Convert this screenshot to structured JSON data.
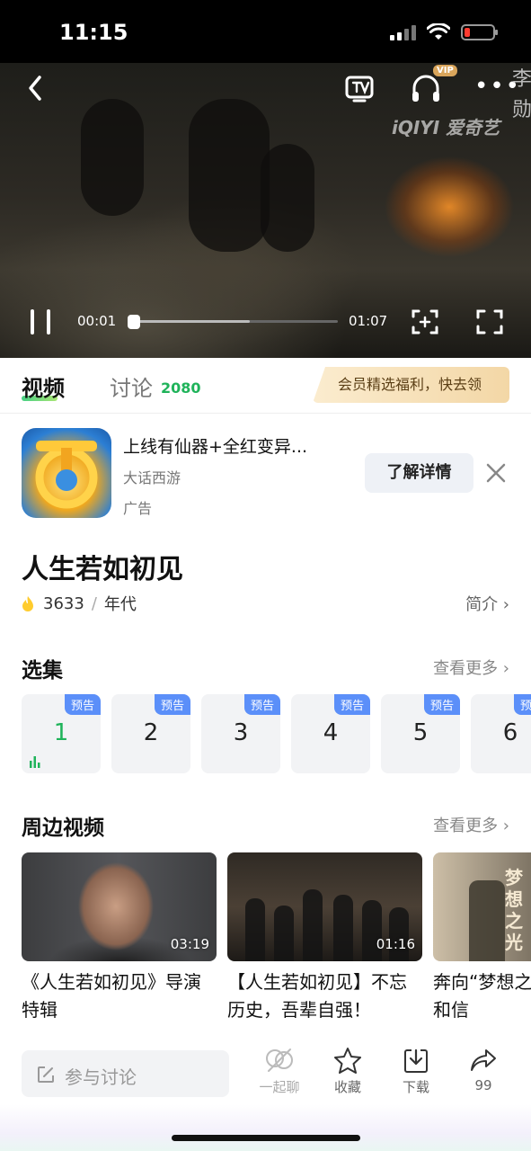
{
  "status_bar": {
    "time": "11:15"
  },
  "player": {
    "watermark": "iQIYI 爱奇艺",
    "vip_badge": "VIP",
    "cut_text": "李勋",
    "current_time": "00:01",
    "total_time": "01:07",
    "progress_fraction": 0.01,
    "buffered_fraction": 0.58
  },
  "tabs": {
    "video": "视频",
    "discuss": "讨论",
    "discuss_count": "2080",
    "promo": "会员精选福利，快去领"
  },
  "ad": {
    "title": "上线有仙器+全红变异...",
    "brand": "大话西游",
    "label": "广告",
    "cta": "了解详情"
  },
  "show": {
    "title": "人生若如初见",
    "heat": "3633",
    "separator": "/",
    "category": "年代",
    "intro": "简介 ›"
  },
  "episodes_section": {
    "title": "选集",
    "more": "查看更多 ›",
    "items": [
      {
        "num": "1",
        "badge": "预告",
        "active": true
      },
      {
        "num": "2",
        "badge": "预告"
      },
      {
        "num": "3",
        "badge": "预告"
      },
      {
        "num": "4",
        "badge": "预告"
      },
      {
        "num": "5",
        "badge": "预告"
      },
      {
        "num": "6",
        "badge": "预告"
      }
    ]
  },
  "related_section": {
    "title": "周边视频",
    "more": "查看更多 ›",
    "items": [
      {
        "title": "《人生若如初见》导演特辑",
        "duration": "03:19"
      },
      {
        "title": "【人生若如初见】不忘历史，吾辈自强！",
        "duration": "01:16"
      },
      {
        "title": "奔向“梦想之光”为初心和信",
        "duration": "",
        "thumb_text": "梦想之光"
      }
    ]
  },
  "bottom_bar": {
    "discuss_placeholder": "参与讨论",
    "actions": [
      {
        "label": "一起聊",
        "icon": "chat-together-icon"
      },
      {
        "label": "收藏",
        "icon": "star-icon"
      },
      {
        "label": "下载",
        "icon": "download-icon"
      },
      {
        "label": "99",
        "icon": "share-icon"
      }
    ]
  },
  "colors": {
    "accent_green": "#1fb35a",
    "badge_blue": "#5b8ff9",
    "promo_gold": "#f3d7a6"
  }
}
